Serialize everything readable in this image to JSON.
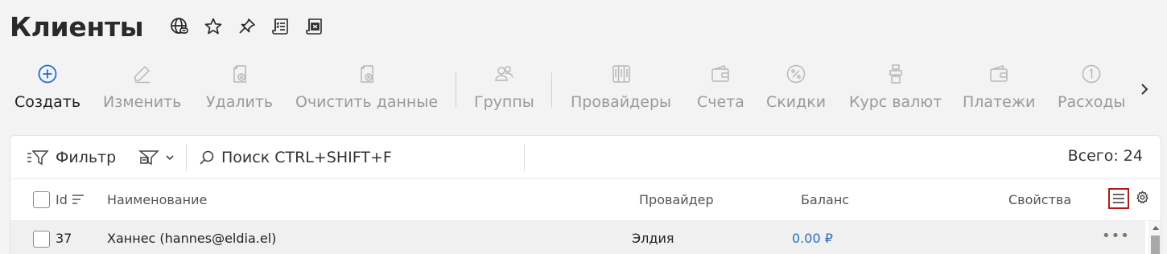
{
  "page": {
    "title": "Клиенты"
  },
  "title_icons": [
    "globe-link-icon",
    "star-icon",
    "pin-icon",
    "checklist-icon",
    "excel-export-icon"
  ],
  "toolbar": {
    "create": "Создать",
    "edit": "Изменить",
    "delete": "Удалить",
    "clear_data": "Очистить данные",
    "groups": "Группы",
    "providers": "Провайдеры",
    "accounts": "Счета",
    "discounts": "Скидки",
    "currency_rate": "Курс валют",
    "payments": "Платежи",
    "expenses": "Расходы"
  },
  "filter": {
    "label": "Фильтр",
    "search_placeholder": "Поиск CTRL+SHIFT+F",
    "total": "Всего: 24"
  },
  "table": {
    "columns": {
      "id": "Id",
      "name": "Наименование",
      "provider": "Провайдер",
      "balance": "Баланс",
      "properties": "Свойства"
    },
    "rows": [
      {
        "id": "37",
        "name": "Ханнес (hannes@eldia.el)",
        "provider": "Элдия",
        "balance": "0.00 ₽",
        "actions": "•••"
      }
    ]
  },
  "colors": {
    "accent": "#1e6fd9",
    "balance": "#2a6ebb",
    "highlight": "#b01b1b",
    "disabled": "#9a9a9a"
  }
}
